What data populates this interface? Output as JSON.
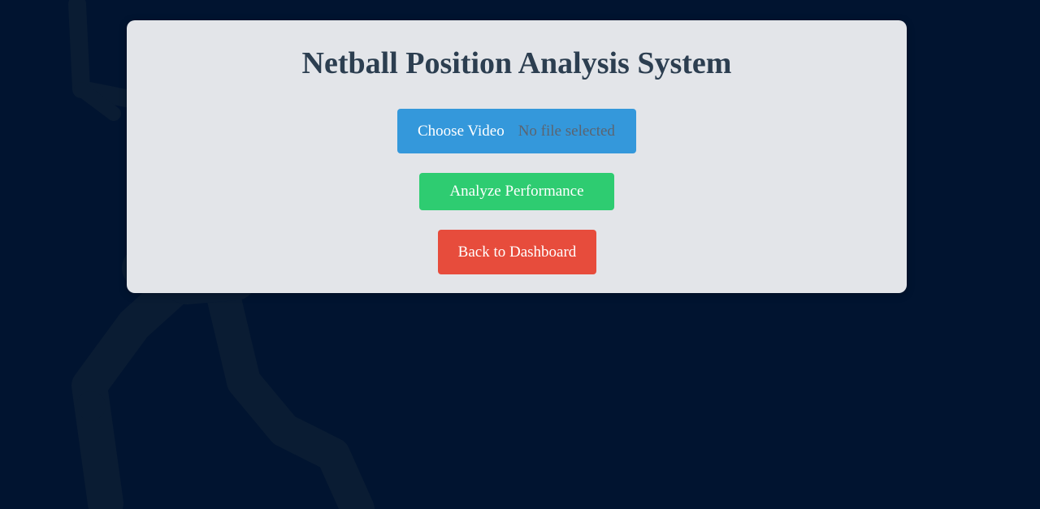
{
  "page": {
    "title": "Netball Position Analysis System"
  },
  "upload": {
    "button_label": "Choose Video",
    "status_text": "No file selected"
  },
  "actions": {
    "analyze_label": "Analyze Performance",
    "back_label": "Back to Dashboard"
  },
  "colors": {
    "background": "#011430",
    "card": "#eaecef",
    "title": "#2c3e50",
    "choose_video": "#3498db",
    "analyze": "#2ecc71",
    "back": "#e74c3c"
  }
}
